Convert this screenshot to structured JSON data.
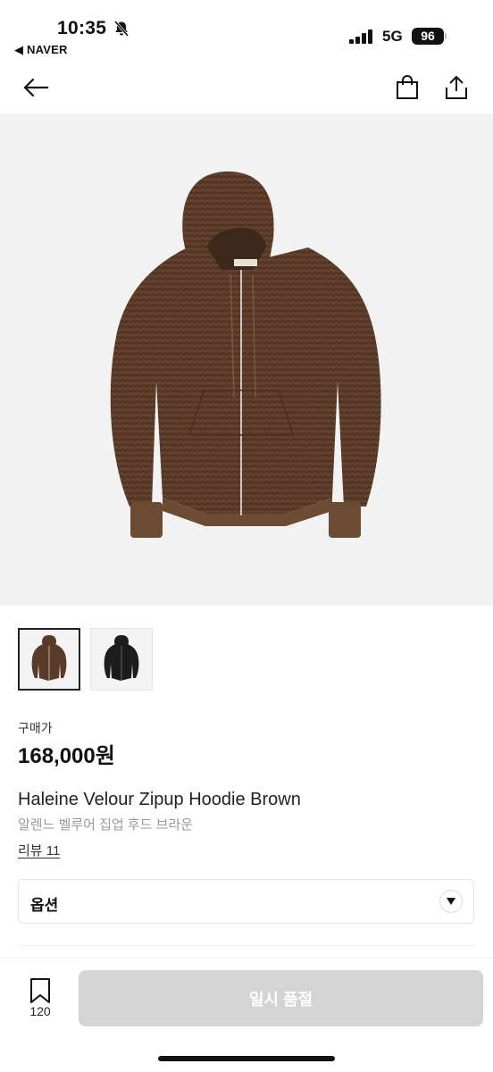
{
  "status_bar": {
    "time": "10:35",
    "back_app": "◀ NAVER",
    "network": "5G",
    "battery": "96"
  },
  "nav": {
    "back_icon": "arrow-left-icon",
    "cart_icon": "shopping-bag-icon",
    "share_icon": "share-icon"
  },
  "product": {
    "hero_alt": "brown velour zip-up hoodie",
    "thumbnails": [
      {
        "color": "#5a3a28",
        "selected": true
      },
      {
        "color": "#1c1c1c",
        "selected": false
      }
    ],
    "price_label": "구매가",
    "price": "168,000원",
    "name_en": "Haleine Velour Zipup Hoodie Brown",
    "name_ko": "알렌느 벨루어 집업 후드 브라운",
    "review": "리뷰 11"
  },
  "options": {
    "label": "옵션"
  },
  "bottom_bar": {
    "wish_count": "120",
    "buy_label": "일시 품절"
  },
  "colors": {
    "accent_disabled": "#d4d4d4",
    "hoodie_brown": "#5a3a28"
  }
}
